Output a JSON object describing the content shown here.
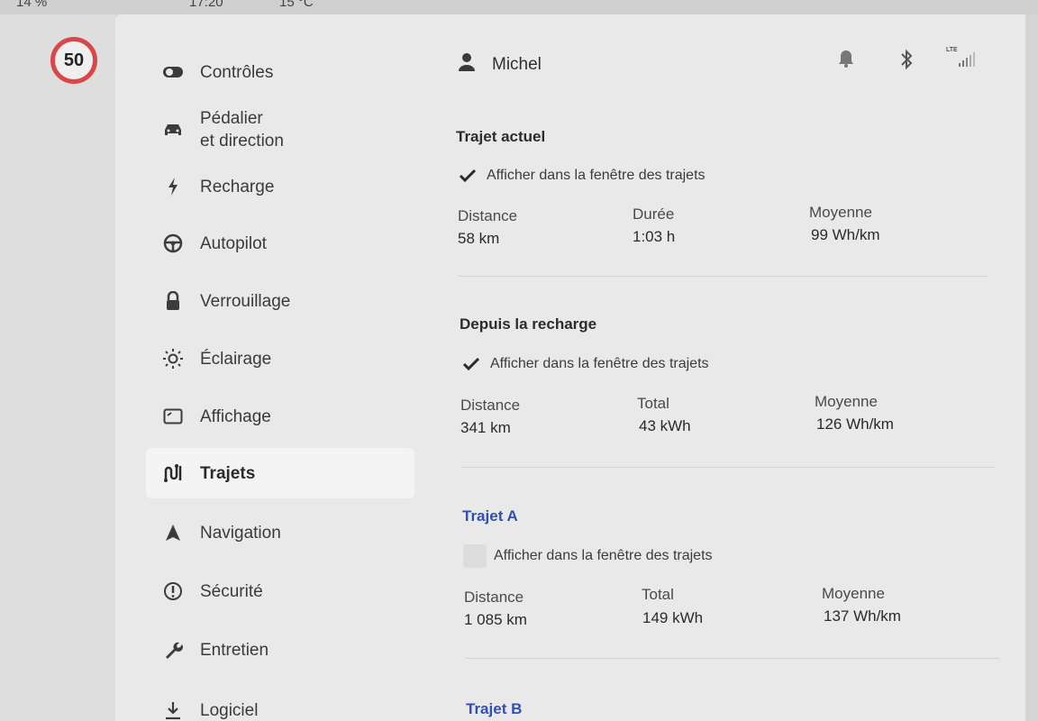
{
  "status_bar": {
    "battery": "14 %",
    "time": "17:20",
    "temp": "15 °C"
  },
  "speed_limit": "50",
  "user": {
    "name": "Michel"
  },
  "status_icons": {
    "lte_label": "LTE"
  },
  "sidebar": {
    "items": [
      {
        "label": "Contrôles",
        "icon": "toggle-icon"
      },
      {
        "label": "Pédalier\net direction",
        "icon": "car-icon"
      },
      {
        "label": "Recharge",
        "icon": "lightning-icon"
      },
      {
        "label": "Autopilot",
        "icon": "steering-wheel-icon"
      },
      {
        "label": "Verrouillage",
        "icon": "lock-icon"
      },
      {
        "label": "Éclairage",
        "icon": "sun-icon"
      },
      {
        "label": "Affichage",
        "icon": "display-icon"
      },
      {
        "label": "Trajets",
        "icon": "route-icon"
      },
      {
        "label": "Navigation",
        "icon": "navigation-arrow-icon"
      },
      {
        "label": "Sécurité",
        "icon": "alert-circle-icon"
      },
      {
        "label": "Entretien",
        "icon": "wrench-icon"
      },
      {
        "label": "Logiciel",
        "icon": "download-icon"
      }
    ],
    "active": "Trajets"
  },
  "sections": {
    "current": {
      "title": "Trajet actuel",
      "checkbox_label": "Afficher dans la fenêtre des trajets",
      "checked": true,
      "labels": [
        "Distance",
        "Durée",
        "Moyenne"
      ],
      "values": [
        "58 km",
        "1:03 h",
        "99 Wh/km"
      ]
    },
    "since_charge": {
      "title": "Depuis la recharge",
      "checkbox_label": "Afficher dans la fenêtre des trajets",
      "checked": true,
      "labels": [
        "Distance",
        "Total",
        "Moyenne"
      ],
      "values": [
        "341 km",
        "43 kWh",
        "126 Wh/km"
      ]
    },
    "trip_a": {
      "title": "Trajet A",
      "checkbox_label": "Afficher dans la fenêtre des trajets",
      "checked": false,
      "labels": [
        "Distance",
        "Total",
        "Moyenne"
      ],
      "values": [
        "1 085 km",
        "149 kWh",
        "137 Wh/km"
      ]
    },
    "trip_b": {
      "title": "Trajet B"
    }
  }
}
